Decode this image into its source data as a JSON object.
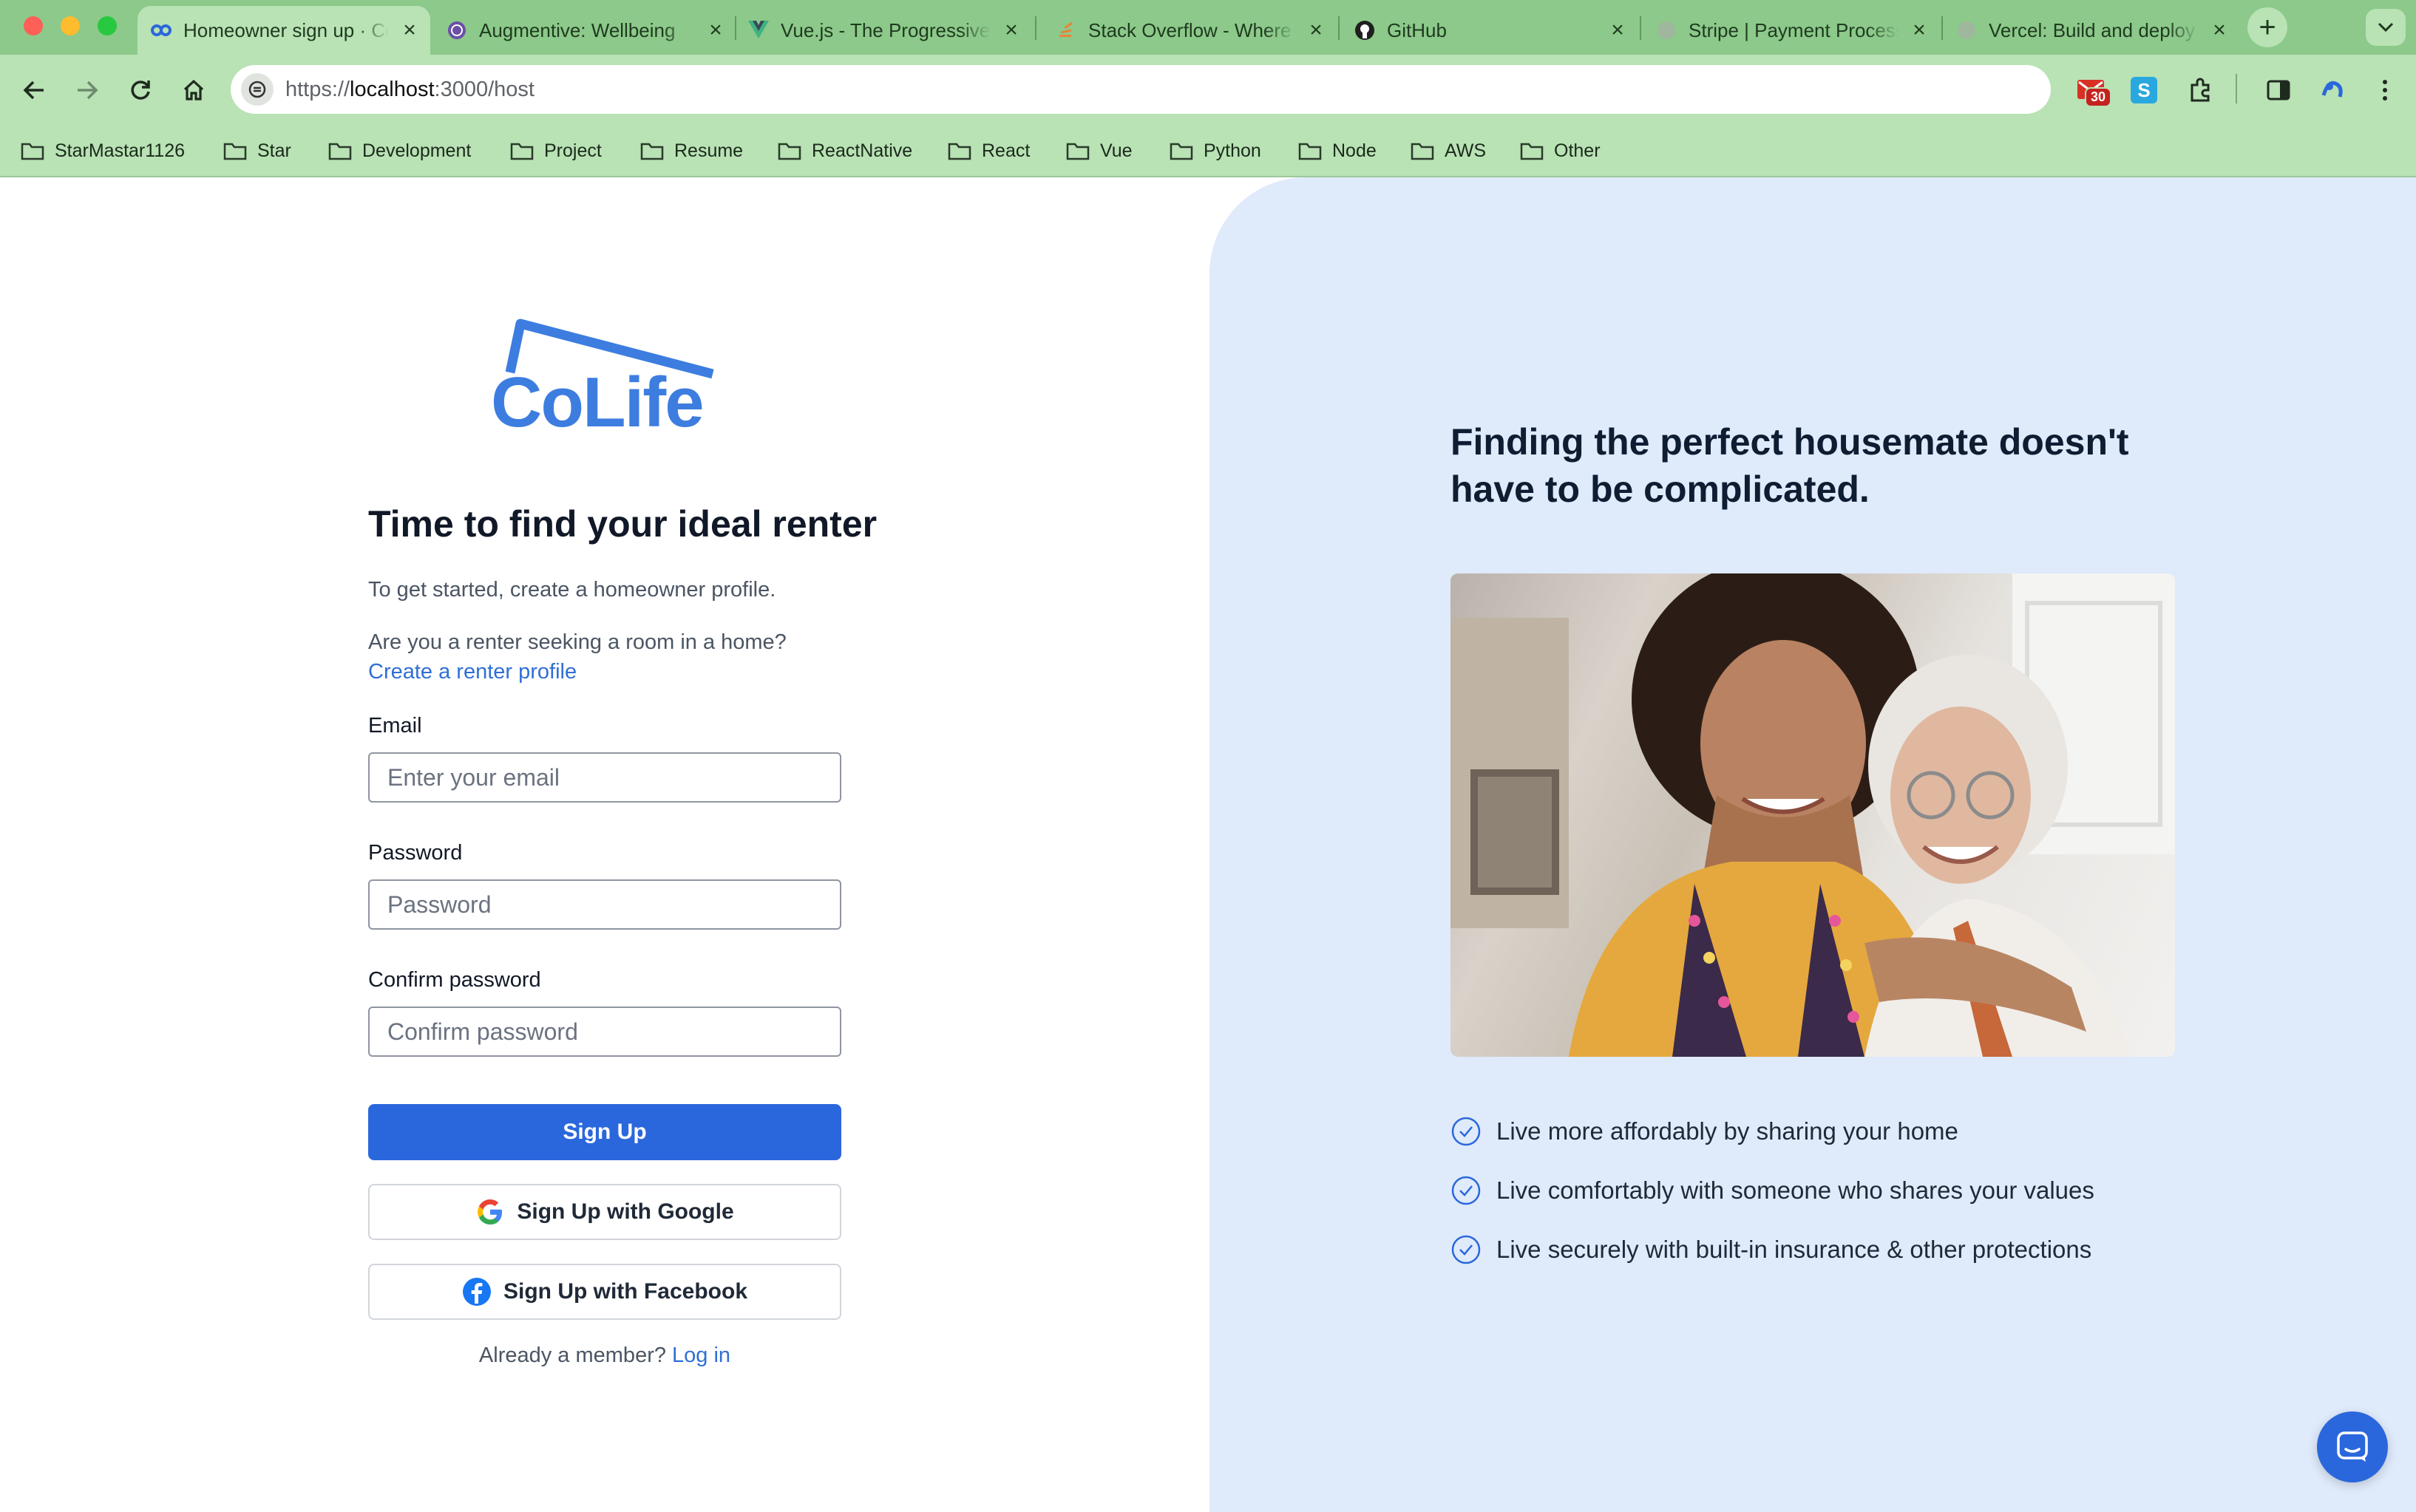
{
  "browser": {
    "tabs": [
      {
        "title": "Homeowner sign up · CoLife",
        "icon": "colife-favicon-icon",
        "active": true
      },
      {
        "title": "Augmentive: Wellbeing",
        "icon": "augmentive-favicon-icon"
      },
      {
        "title": "Vue.js - The Progressive",
        "icon": "vue-favicon-icon"
      },
      {
        "title": "Stack Overflow - Where",
        "icon": "stackoverflow-favicon-icon"
      },
      {
        "title": "GitHub",
        "icon": "github-favicon-icon"
      },
      {
        "title": "Stripe | Payment Processing",
        "icon": "stripe-favicon-icon"
      },
      {
        "title": "Vercel: Build and deploy",
        "icon": "vercel-favicon-icon"
      }
    ],
    "url_prefix": "https://",
    "url_host": "localhost",
    "url_rest": ":3000/host",
    "extension_badge": "30",
    "bookmarks": [
      "StarMastar1126",
      "Star",
      "Development",
      "Project",
      "Resume",
      "ReactNative",
      "React",
      "Vue",
      "Python",
      "Node",
      "AWS",
      "Other"
    ]
  },
  "logo": {
    "text": "CoLife"
  },
  "form": {
    "title": "Time to find your ideal renter",
    "subtitle": "To get started, create a homeowner profile.",
    "renter_question": "Are you a renter seeking a room in a home?",
    "renter_link": "Create a renter profile",
    "email_label": "Email",
    "email_placeholder": "Enter your email",
    "password_label": "Password",
    "password_placeholder": "Password",
    "confirm_label": "Confirm password",
    "confirm_placeholder": "Confirm password",
    "signup_button": "Sign Up",
    "google_button": "Sign Up with Google",
    "facebook_button": "Sign Up with Facebook",
    "member_text": "Already a member?",
    "login_link": "Log in"
  },
  "promo": {
    "heading": "Finding the perfect housemate doesn't have to be complicated.",
    "features": [
      "Live more affordably by sharing your home",
      "Live comfortably with someone who shares your values",
      "Live securely with built-in insurance & other protections"
    ]
  },
  "colors": {
    "primary": "#2b67dc",
    "panel": "#dfeafb",
    "chrome": "#8cc98a"
  }
}
